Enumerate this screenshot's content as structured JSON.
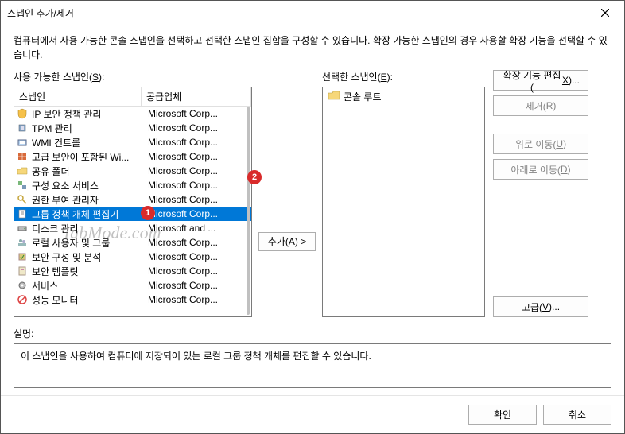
{
  "title": "스냅인 추가/제거",
  "description": "컴퓨터에서 사용 가능한 콘솔 스냅인을 선택하고 선택한 스냅인 집합을 구성할 수 있습니다. 확장 가능한 스냅인의 경우 사용할 확장 기능을 선택할 수 있습니다.",
  "available_label": "사용 가능한 스냅인(",
  "available_hotkey": "S",
  "available_label_end": "):",
  "selected_label": "선택한 스냅인(",
  "selected_hotkey": "E",
  "selected_label_end": "):",
  "col_snapin": "스냅인",
  "col_vendor": "공급업체",
  "rows": [
    {
      "name": "IP 보안 정책 관리",
      "vendor": "Microsoft Corp...",
      "icon": "shield"
    },
    {
      "name": "TPM 관리",
      "vendor": "Microsoft Corp...",
      "icon": "chip"
    },
    {
      "name": "WMI 컨트롤",
      "vendor": "Microsoft Corp...",
      "icon": "wmi"
    },
    {
      "name": "고급 보안이 포함된 Wi...",
      "vendor": "Microsoft Corp...",
      "icon": "firewall"
    },
    {
      "name": "공유 폴더",
      "vendor": "Microsoft Corp...",
      "icon": "folder-share"
    },
    {
      "name": "구성 요소 서비스",
      "vendor": "Microsoft Corp...",
      "icon": "component"
    },
    {
      "name": "권한 부여 관리자",
      "vendor": "Microsoft Corp...",
      "icon": "key"
    },
    {
      "name": "그룹 정책 개체 편집기",
      "vendor": "Microsoft Corp...",
      "icon": "doc",
      "selected": true
    },
    {
      "name": "디스크 관리",
      "vendor": "Microsoft and ...",
      "icon": "disk"
    },
    {
      "name": "로컬 사용자 및 그룹",
      "vendor": "Microsoft Corp...",
      "icon": "users"
    },
    {
      "name": "보안 구성 및 분석",
      "vendor": "Microsoft Corp...",
      "icon": "secdb"
    },
    {
      "name": "보안 템플릿",
      "vendor": "Microsoft Corp...",
      "icon": "sectempl"
    },
    {
      "name": "서비스",
      "vendor": "Microsoft Corp...",
      "icon": "gear"
    },
    {
      "name": "성능 모니터",
      "vendor": "Microsoft Corp...",
      "icon": "perf"
    }
  ],
  "selected_tree_root": "콘솔 루트",
  "btn_add": "추가(",
  "btn_add_hotkey": "A",
  "btn_add_end": ") >",
  "btn_ext": "확장 기능 편집(",
  "btn_ext_hotkey": "X",
  "btn_ext_end": ")...",
  "btn_remove": "제거(",
  "btn_remove_hotkey": "R",
  "btn_remove_end": ")",
  "btn_up": "위로 이동(",
  "btn_up_hotkey": "U",
  "btn_up_end": ")",
  "btn_down": "아래로 이동(",
  "btn_down_hotkey": "D",
  "btn_down_end": ")",
  "btn_adv": "고급(",
  "btn_adv_hotkey": "V",
  "btn_adv_end": ")...",
  "explain_label": "설명:",
  "explain_text": "이 스냅인을 사용하여 컴퓨터에 저장되어 있는 로컬 그룹 정책 개체를 편집할 수 있습니다.",
  "btn_ok": "확인",
  "btn_cancel": "취소",
  "badge1": "1",
  "badge2": "2",
  "watermark": "TabMode.com"
}
